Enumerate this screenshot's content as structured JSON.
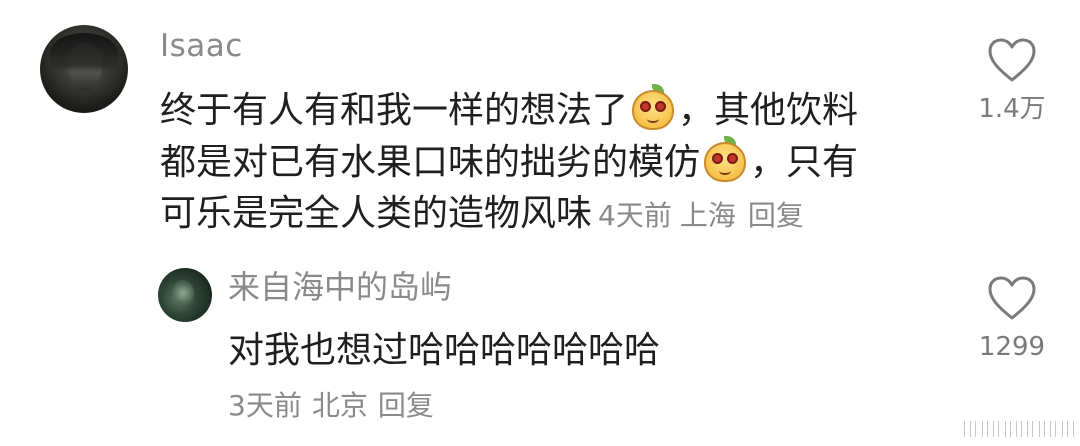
{
  "comment": {
    "username": "Isaac",
    "lines": [
      {
        "before": "终于有人有和我一样的想法了",
        "after": "，其他饮料"
      },
      {
        "before": "都是对已有水果口味的拙劣的模仿",
        "after": "，只有"
      },
      {
        "before": "可乐是完全人类的造物风味"
      }
    ],
    "meta": {
      "time": "4天前",
      "location": "上海",
      "reply_label": "回复"
    },
    "likes": "1.4万"
  },
  "reply": {
    "username": "来自海中的岛屿",
    "content": "对我也想过哈哈哈哈哈哈哈",
    "meta": {
      "time": "3天前",
      "location": "北京",
      "reply_label": "回复"
    },
    "likes": "1299"
  },
  "icons": {
    "heart": "heart-outline-icon",
    "emoji": "pear-emoji-icon"
  },
  "colors": {
    "text": "#1f1f1f",
    "muted": "#8a8a8a",
    "background": "#ffffff"
  }
}
